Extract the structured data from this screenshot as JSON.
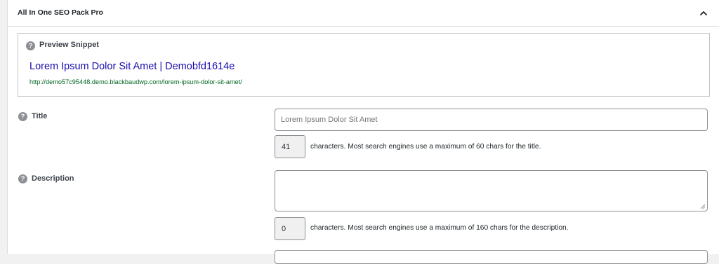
{
  "panel": {
    "title": "All In One SEO Pack Pro",
    "collapse_icon": "chevron-up-icon"
  },
  "preview": {
    "help_glyph": "?",
    "label": "Preview Snippet",
    "snippet_title": "Lorem Ipsum Dolor Sit Amet | Demobfd1614e",
    "snippet_url": "http://demo57c95448.demo.blackbaudwp.com/lorem-ipsum-dolor-sit-amet/"
  },
  "title_field": {
    "help_glyph": "?",
    "label": "Title",
    "placeholder": "Lorem Ipsum Dolor Sit Amet",
    "value": "",
    "char_count": "41",
    "counter_text": "characters. Most search engines use a maximum of 60 chars for the title."
  },
  "description_field": {
    "help_glyph": "?",
    "label": "Description",
    "value": "",
    "char_count": "0",
    "counter_text": "characters. Most search engines use a maximum of 160 chars for the description."
  },
  "colors": {
    "snippet_title": "#1a0dab",
    "snippet_url": "#006621",
    "help_icon": "#8c8f94",
    "border": "#c3c4c7"
  }
}
